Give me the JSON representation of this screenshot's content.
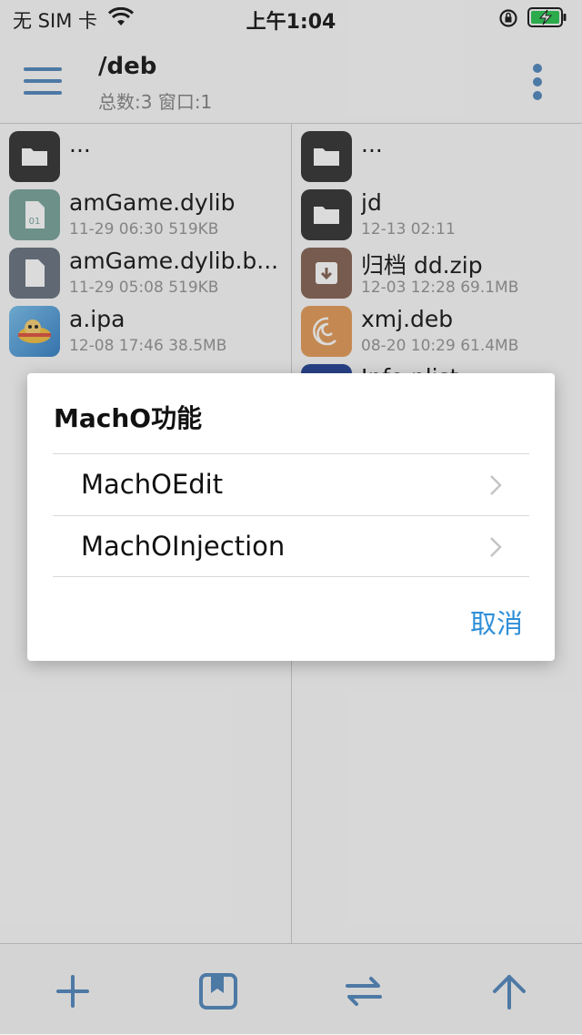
{
  "status_bar": {
    "carrier": "无 SIM 卡",
    "time": "上午1:04"
  },
  "header": {
    "title": "/deb",
    "subtitle": "总数:3 窗口:1"
  },
  "left_pane": {
    "items": [
      {
        "name": "...",
        "meta": "",
        "icon": "folder-icon"
      },
      {
        "name": "amGame.dylib",
        "meta": "11-29 06:30 519KB",
        "icon": "dylib-file-icon"
      },
      {
        "name": "amGame.dylib.b...",
        "meta": "11-29 05:08 519KB",
        "icon": "file-icon"
      },
      {
        "name": "a.ipa",
        "meta": "12-08 17:46 38.5MB",
        "icon": "ipa-app-icon"
      }
    ]
  },
  "right_pane": {
    "items": [
      {
        "name": "...",
        "meta": "",
        "icon": "folder-icon"
      },
      {
        "name": "jd",
        "meta": "12-13 02:11",
        "icon": "folder-icon"
      },
      {
        "name": "归档 dd.zip",
        "meta": "12-03 12:28 69.1MB",
        "icon": "archive-icon"
      },
      {
        "name": "xmj.deb",
        "meta": "08-20 10:29 61.4MB",
        "icon": "deb-package-icon"
      },
      {
        "name": "Info.plist",
        "meta": "",
        "icon": "plist-file-icon"
      }
    ]
  },
  "dialog": {
    "title": "MachO功能",
    "options": [
      {
        "label": "MachOEdit"
      },
      {
        "label": "MachOInjection"
      }
    ],
    "cancel_label": "取消"
  },
  "toolbar": {
    "icons": [
      "plus-icon",
      "bookmark-icon",
      "swap-icon",
      "arrow-up-icon"
    ]
  },
  "colors": {
    "accent": "#5a8dc0",
    "link": "#2f8fd8",
    "battery": "#34c759"
  }
}
